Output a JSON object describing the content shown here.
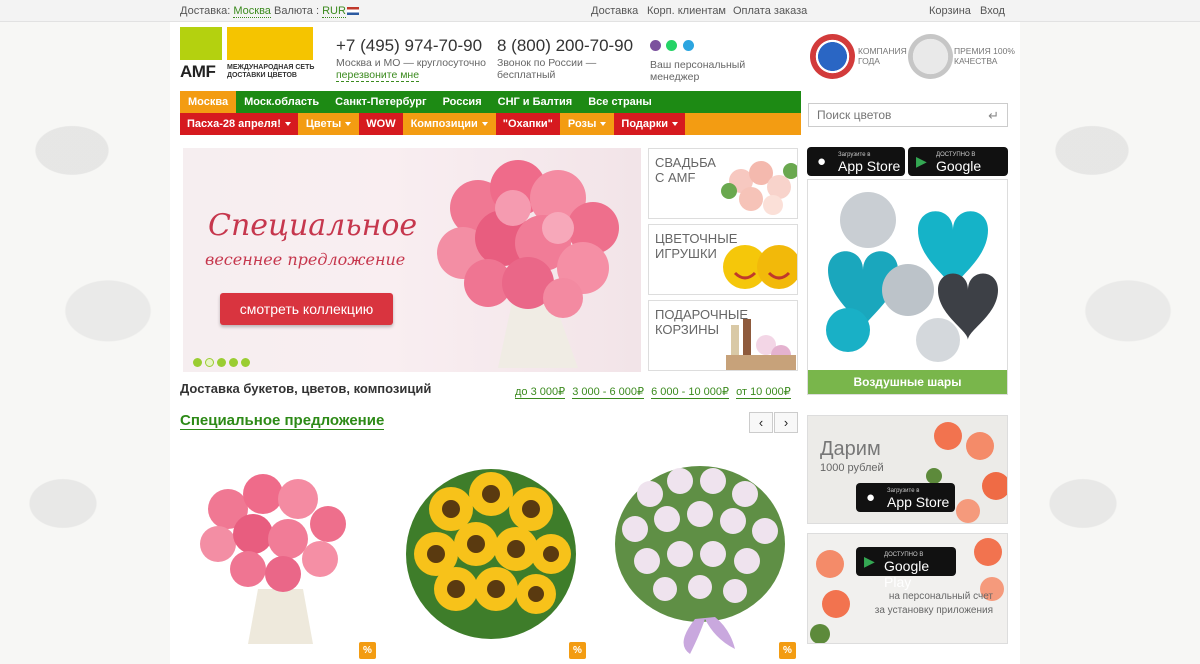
{
  "topbar": {
    "delivery_label": "Доставка:",
    "delivery_city": "Москва",
    "currency_label": "Валюта :",
    "currency": "RUR",
    "links": [
      "Доставка",
      "Корп. клиентам",
      "Оплата заказа"
    ],
    "cart": "Корзина",
    "login": "Вход"
  },
  "logo": {
    "name": "AMF",
    "tagline": "Международная сеть доставки цветов"
  },
  "contacts": {
    "phone1": "+7 (495) 974-70-90",
    "phone1_sub1": "Москва и МО — круглосуточно",
    "phone1_sub2": "перезвоните мне",
    "phone2": "8 (800) 200-70-90",
    "phone2_sub": "Звонок по России — бесплатный",
    "manager": "Ваш персональный менеджер"
  },
  "awards": [
    {
      "text": "Компания года",
      "icon": "company-award-icon"
    },
    {
      "text": "Премия 100% качества",
      "icon": "quality-award-icon"
    }
  ],
  "nav_regions": [
    "Москва",
    "Моск.область",
    "Санкт-Петербург",
    "Россия",
    "СНГ и Балтия",
    "Все страны"
  ],
  "nav_categories": [
    {
      "label": "Пасха-28 апреля!",
      "dropdown": true,
      "style": "red"
    },
    {
      "label": "Цветы",
      "dropdown": true,
      "style": "orange"
    },
    {
      "label": "WOW",
      "dropdown": false,
      "style": "red"
    },
    {
      "label": "Композиции",
      "dropdown": true,
      "style": "orange"
    },
    {
      "label": "\"Охапки\"",
      "dropdown": false,
      "style": "red"
    },
    {
      "label": "Розы",
      "dropdown": true,
      "style": "orange"
    },
    {
      "label": "Подарки",
      "dropdown": true,
      "style": "red"
    }
  ],
  "search": {
    "placeholder": "Поиск цветов"
  },
  "banner": {
    "title": "Специальное",
    "subtitle": "весеннее предложение",
    "button": "смотреть коллекцию",
    "slides_total": 5,
    "slide_active": 2
  },
  "promos": [
    {
      "title": "Свадьба с AMF"
    },
    {
      "title": "Цветочные игрушки"
    },
    {
      "title": "Подарочные корзины"
    }
  ],
  "apps": {
    "appstore_small": "Загрузите в",
    "appstore_big": "App Store",
    "googleplay_small": "ДОСТУПНО В",
    "googleplay_big": "Google Play"
  },
  "balloons_label": "Воздушные шары",
  "gift_card": {
    "title": "Дарим",
    "sub": "1000 рублей"
  },
  "gp_card": {
    "line1": "на персональный счет",
    "line2": "за установку приложения"
  },
  "delivery_heading": "Доставка букетов, цветов, композиций",
  "price_ranges": [
    "до 3 000₽",
    "3 000 - 6 000₽",
    "6 000 - 10 000₽",
    "от 10 000₽"
  ],
  "special_heading": "Специальное предложение",
  "arrows": {
    "prev": "‹",
    "next": "›"
  },
  "discount_badge": "%",
  "colors": {
    "green": "#1d8a14",
    "orange": "#f39c12",
    "red": "#d61a1f",
    "link_green": "#3b8a1e"
  }
}
